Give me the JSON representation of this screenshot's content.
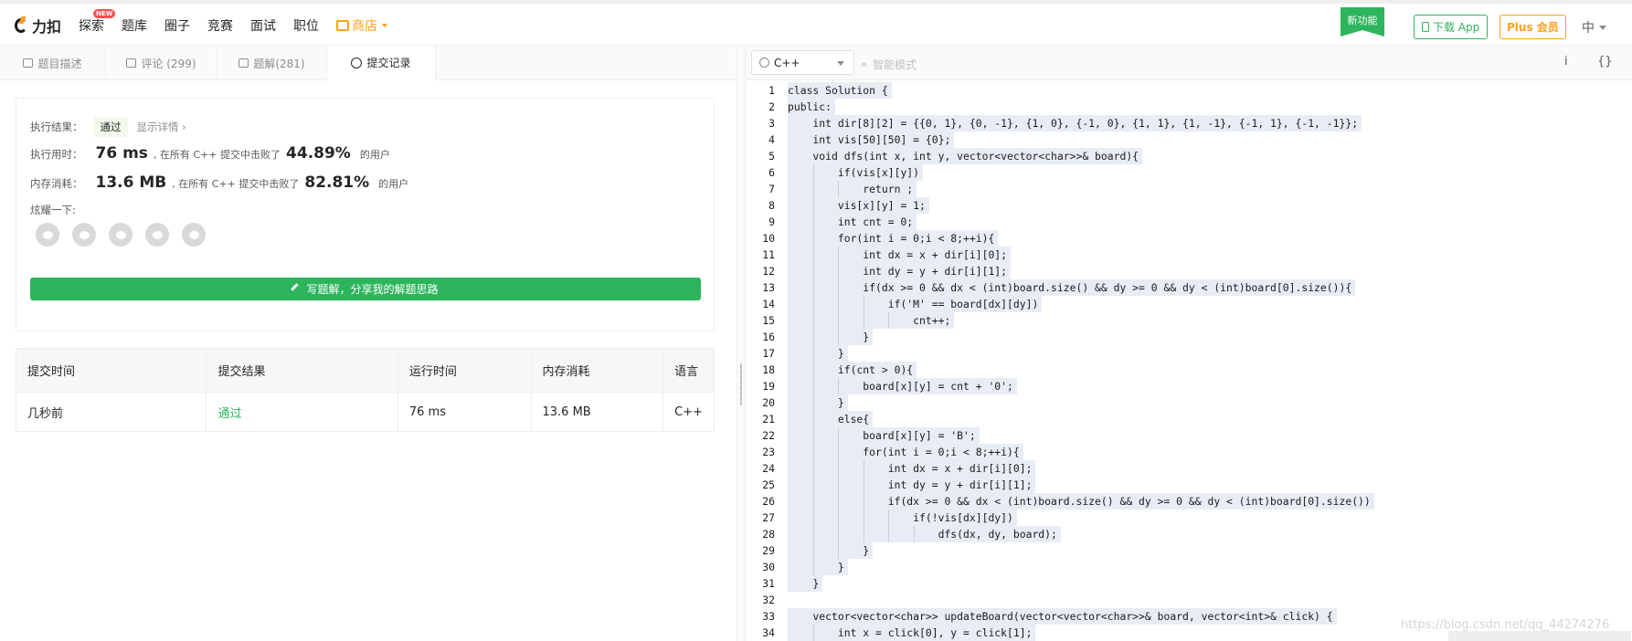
{
  "brand": {
    "name": "力扣"
  },
  "nav": {
    "items": [
      "探索",
      "题库",
      "圈子",
      "竞赛",
      "面试",
      "职位"
    ],
    "new_badge": "NEW",
    "store": "商店"
  },
  "header_right": {
    "new_feature": "新功能",
    "download": "下载 App",
    "plus": "Plus 会员",
    "lang": "中"
  },
  "tabs": [
    {
      "label": "题目描述"
    },
    {
      "label": "评论 (299)"
    },
    {
      "label": "题解(281)"
    },
    {
      "label": "提交记录"
    }
  ],
  "result": {
    "status_label": "执行结果：",
    "status": "通过",
    "show_detail": "显示详情 ›",
    "time_label": "执行用时：",
    "time_value": "76 ms",
    "time_text": ", 在所有 C++ 提交中击败了",
    "time_pct": "44.89%",
    "users": "的用户",
    "mem_label": "内存消耗：",
    "mem_value": "13.6 MB",
    "mem_text": ", 在所有 C++ 提交中击败了",
    "mem_pct": "82.81%",
    "share_label": "炫耀一下:",
    "share_icons": [
      "wechat-icon",
      "weibo-icon",
      "qq-icon",
      "douban-icon",
      "linkedin-icon"
    ],
    "write_button": "写题解，分享我的解题思路"
  },
  "submissions": {
    "headers": [
      "提交时间",
      "提交结果",
      "运行时间",
      "内存消耗",
      "语言"
    ],
    "rows": [
      {
        "time": "几秒前",
        "result": "通过",
        "runtime": "76 ms",
        "memory": "13.6 MB",
        "lang": "C++"
      }
    ]
  },
  "editor": {
    "language": "C++",
    "smart_mode": "智能模式",
    "toolbar_icons": [
      "i",
      "{}"
    ],
    "lines": [
      "class Solution {",
      "public:",
      "    int dir[8][2] = {{0, 1}, {0, -1}, {1, 0}, {-1, 0}, {1, 1}, {1, -1}, {-1, 1}, {-1, -1}};",
      "    int vis[50][50] = {0};",
      "    void dfs(int x, int y, vector<vector<char>>& board){",
      "        if(vis[x][y])",
      "            return ;",
      "        vis[x][y] = 1;",
      "        int cnt = 0;",
      "        for(int i = 0;i < 8;++i){",
      "            int dx = x + dir[i][0];",
      "            int dy = y + dir[i][1];",
      "            if(dx >= 0 && dx < (int)board.size() && dy >= 0 && dy < (int)board[0].size()){",
      "                if('M' == board[dx][dy])",
      "                    cnt++;",
      "            }",
      "        }",
      "        if(cnt > 0){",
      "            board[x][y] = cnt + '0';",
      "        }",
      "        else{",
      "            board[x][y] = 'B';",
      "            for(int i = 0;i < 8;++i){",
      "                int dx = x + dir[i][0];",
      "                int dy = y + dir[i][1];",
      "                if(dx >= 0 && dx < (int)board.size() && dy >= 0 && dy < (int)board[0].size())",
      "                    if(!vis[dx][dy])",
      "                        dfs(dx, dy, board);",
      "            }",
      "        }",
      "    }",
      "",
      "    vector<vector<char>> updateBoard(vector<vector<char>>& board, vector<int>& click) {",
      "        int x = click[0], y = click[1];"
    ]
  },
  "watermark": "https://blog.csdn.net/qq_44274276"
}
